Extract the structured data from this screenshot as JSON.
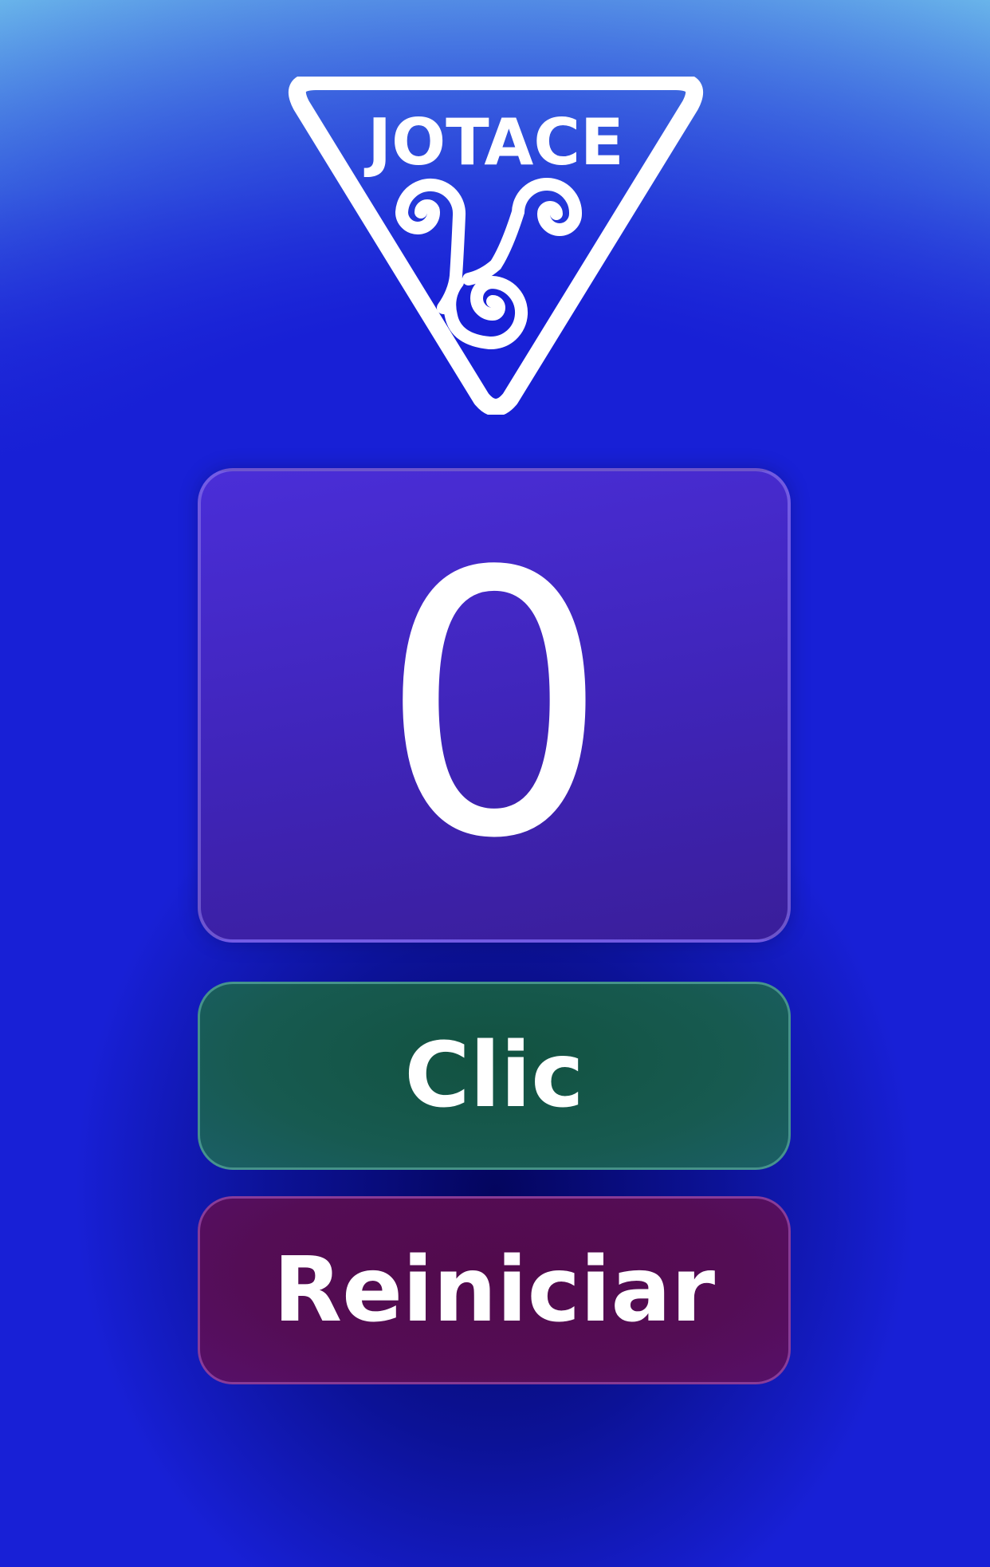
{
  "logo": {
    "text": "JOTACE",
    "icon": "triskelion-triangle-logo",
    "color": "#ffffff"
  },
  "counter": {
    "value": "0"
  },
  "buttons": {
    "click_label": "Clic",
    "reset_label": "Reiniciar"
  },
  "colors": {
    "background": "#1a20d6",
    "panel": "#4228c8",
    "click_button": "#155447",
    "reset_button": "#530c52"
  }
}
